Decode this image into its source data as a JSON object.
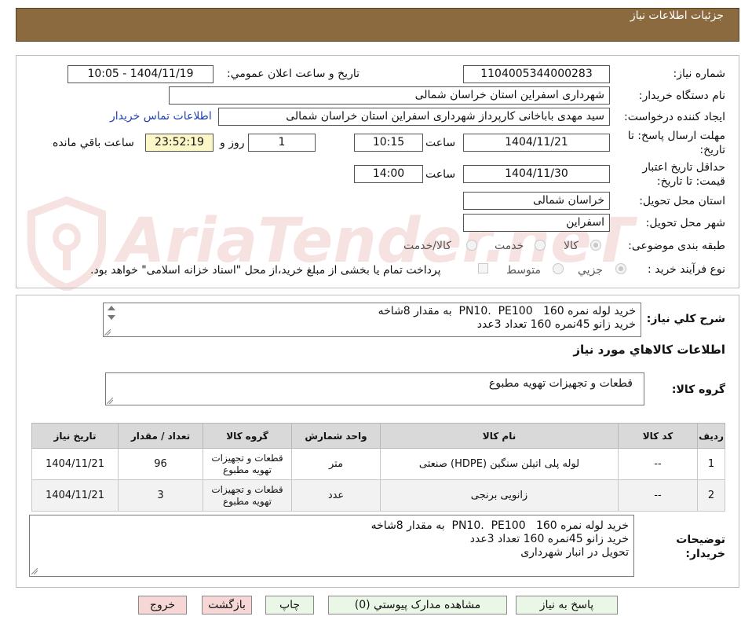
{
  "header": {
    "title": "جزئیات اطلاعات نیاز"
  },
  "watermark": {
    "text": "AriaTender.neT",
    "color": "#c62828"
  },
  "form": {
    "need_number": {
      "label": "شماره نیاز:",
      "value": "1104005344000283"
    },
    "announce": {
      "label": "تاریخ و ساعت اعلان عمومي:",
      "value": "1404/11/19 - 10:05"
    },
    "buyer_org": {
      "label": "نام دستگاه خریدار:",
      "value": "شهرداری اسفراین استان خراسان شمالی"
    },
    "requester": {
      "label": "ایجاد کننده درخواست:",
      "value": "سید مهدی  باباخانی کارپرداز   شهرداری اسفراین استان خراسان شمالی"
    },
    "contact_link": "اطلاعات تماس خریدار",
    "deadline": {
      "label_line1": "مهلت ارسال پاسخ: تا",
      "label_line2": "تاریخ:",
      "date": "1404/11/21",
      "time_label": "ساعت",
      "time": "10:15",
      "days": "1",
      "days_label": "روز و",
      "remaining": "23:52:19",
      "remaining_label": "ساعت باقي مانده"
    },
    "validity": {
      "label_line1": "حداقل تاریخ اعتبار",
      "label_line2": "قیمت: تا تاریخ:",
      "date": "1404/11/30",
      "time_label": "ساعت",
      "time": "14:00"
    },
    "province": {
      "label": "استان محل تحویل:",
      "value": "خراسان شمالی"
    },
    "city": {
      "label": "شهر محل تحویل:",
      "value": "اسفراین"
    },
    "category": {
      "label": "طبقه بندی موضوعی:",
      "options": [
        "کالا",
        "خدمت",
        "کالا/خدمت"
      ]
    },
    "process": {
      "label": "نوع فرآیند خرید :",
      "options": [
        "جزیي",
        "متوسط"
      ],
      "note": "پرداخت تمام یا بخشی از مبلغ خرید،از محل \"اسناد خزانه اسلامی\" خواهد بود."
    }
  },
  "summary": {
    "label": "شرح کلي نیاز:",
    "text": "خرید لوله نمره 160   PN10.  PE100  به مقدار 8شاخه\nخرید زانو 45نمره 160 تعداد 3عدد"
  },
  "goods_section": {
    "title": "اطلاعات کالاهاي مورد نیاز",
    "group_label": "گروه کالا:",
    "group_value": "قطعات و تجهیزات تهویه مطبوع"
  },
  "table": {
    "headers": [
      "ردیف",
      "کد کالا",
      "نام کالا",
      "واحد شمارش",
      "گروه کالا",
      "تعداد / مقدار",
      "تاریخ نیاز"
    ],
    "rows": [
      {
        "row": "1",
        "code": "--",
        "name": "لوله پلی اتیلن سنگین (HDPE) صنعتی",
        "unit": "متر",
        "group": "قطعات و تجهیزات تهویه مطبوع",
        "qty": "96",
        "date": "1404/11/21"
      },
      {
        "row": "2",
        "code": "--",
        "name": "زانویی برنجی",
        "unit": "عدد",
        "group": "قطعات و تجهیزات تهویه مطبوع",
        "qty": "3",
        "date": "1404/11/21"
      }
    ]
  },
  "buyer_notes": {
    "label_line1": "توضیحات",
    "label_line2": "خریدار:",
    "text": "خرید لوله نمره 160   PN10.  PE100  به مقدار 8شاخه\nخرید زانو 45نمره 160 تعداد 3عدد\nتحویل در انبار شهرداری"
  },
  "buttons": {
    "reply": "پاسخ به نیاز",
    "attachments": "مشاهده مدارک پیوستي (0)",
    "print": "چاپ",
    "back": "بازگشت",
    "exit": "خروج"
  }
}
